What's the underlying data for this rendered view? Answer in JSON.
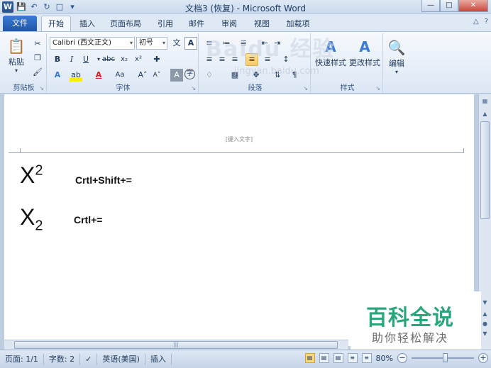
{
  "titlebar": {
    "app_icon": "W",
    "title": "文档3 (恢复) - Microsoft Word",
    "icons": [
      "save-icon",
      "undo-icon",
      "redo-icon",
      "new-doc-icon",
      "customize-qat-icon"
    ]
  },
  "tabs": {
    "file": "文件",
    "items": [
      "开始",
      "插入",
      "页面布局",
      "引用",
      "邮件",
      "审阅",
      "视图",
      "加载项"
    ],
    "active": "开始"
  },
  "ribbon": {
    "clipboard": {
      "label": "剪贴板",
      "paste": "粘贴"
    },
    "font": {
      "label": "字体",
      "font_name": "Calibri (西文正文)",
      "font_size": "初号"
    },
    "paragraph": {
      "label": "段落"
    },
    "styles": {
      "label": "样式",
      "quick_styles": "快速样式",
      "change_styles": "更改样式"
    },
    "editing": {
      "label": "编辑",
      "edit": "编辑"
    }
  },
  "document": {
    "header_hint": "[键入文字]",
    "line1": {
      "base": "X",
      "mark": "2",
      "shortcut": "Crtl+Shift+="
    },
    "line2": {
      "base": "X",
      "mark": "2",
      "shortcut": "Crtl+="
    }
  },
  "watermark": {
    "title": "百科全说",
    "subtitle": "助你轻松解决",
    "overlay": "Baidu 经验",
    "overlay_url": "jingyan.baidu.com"
  },
  "statusbar": {
    "page": "页面: 1/1",
    "words": "字数: 2",
    "language": "英语(美国)",
    "mode": "插入",
    "zoom": "80%"
  },
  "colors": {
    "file_tab": "#1f56a8",
    "watermark_green": "#2aa77a"
  }
}
